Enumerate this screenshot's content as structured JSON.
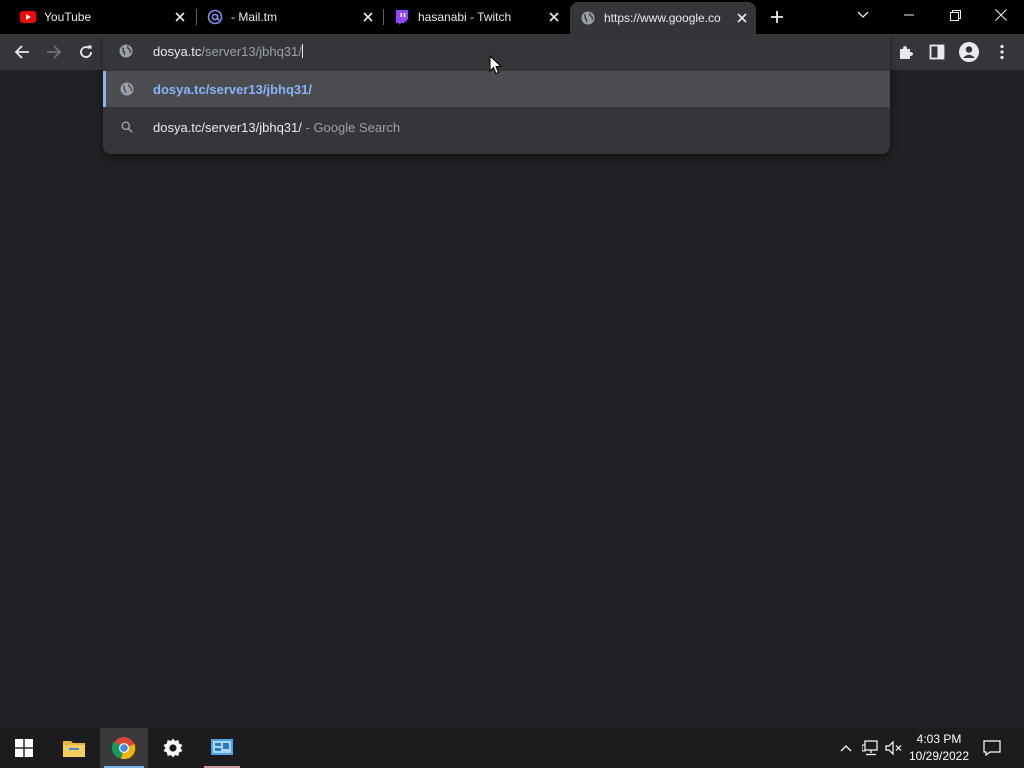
{
  "tabs": [
    {
      "title": "YouTube",
      "icon": "youtube-icon"
    },
    {
      "title": "- Mail.tm",
      "icon": "at-sign-icon"
    },
    {
      "title": "hasanabi - Twitch",
      "icon": "twitch-icon"
    },
    {
      "title": "https://www.google.co",
      "icon": "globe-icon",
      "active": true
    }
  ],
  "omnibox": {
    "typed": "dosya.tc",
    "autocomplete": "/server13/jbhq31/",
    "suggestions": [
      {
        "icon": "globe-icon",
        "text": "dosya.tc/server13/jbhq31/",
        "suffix": "",
        "selected": true
      },
      {
        "icon": "search-icon",
        "text": "dosya.tc/server13/jbhq31/",
        "suffix": "- Google Search",
        "selected": false
      }
    ]
  },
  "taskbar": {
    "apps": [
      "start-button",
      "file-explorer",
      "chrome",
      "settings",
      "control-panel"
    ],
    "clock": {
      "time": "4:03 PM",
      "date": "10/29/2022"
    }
  },
  "colors": {
    "tab_strip": "#000000",
    "toolbar": "#35363a",
    "page_bg": "#202124",
    "accent": "#8ab4f8",
    "taskbar": "#1c1c1e"
  }
}
